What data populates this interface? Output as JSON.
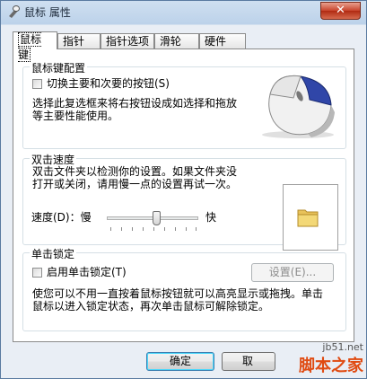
{
  "window": {
    "title": "鼠标 属性",
    "close_symbol": "✕"
  },
  "tabs": [
    "鼠标键",
    "指针",
    "指针选项",
    "滑轮",
    "硬件"
  ],
  "buttons_group": {
    "title": "鼠标键配置",
    "checkbox_label": "切换主要和次要的按钮(S)",
    "checked": false,
    "description_line1": "选择此复选框来将右按钮设成如选择和拖放",
    "description_line2": "等主要性能使用。"
  },
  "double_click": {
    "title": "双击速度",
    "description_line1": "双击文件夹以检测你的设置。如果文件夹没",
    "description_line2": "打开或关闭，请用慢一点的设置再试一次。",
    "speed_label": "速度(D)：慢",
    "fast_label": "快",
    "speed_level": 0.55
  },
  "click_lock": {
    "title": "单击锁定",
    "checkbox_label": "启用单击锁定(T)",
    "checked": false,
    "settings_button": "设置(E)...",
    "description_line1": "使您可以不用一直按着鼠标按钮就可以高亮显示或拖拽。单击",
    "description_line2": "鼠标以进入锁定状态，再次单击鼠标可解除锁定。"
  },
  "footer": {
    "ok_label": "确定",
    "cancel_partial": "取"
  },
  "watermark": {
    "url": "jb51.net",
    "name": "脚本之家"
  },
  "icons": [
    "mouse-properties-icon",
    "close-icon",
    "mouse-illustration",
    "folder-icon",
    "slider-thumb"
  ]
}
